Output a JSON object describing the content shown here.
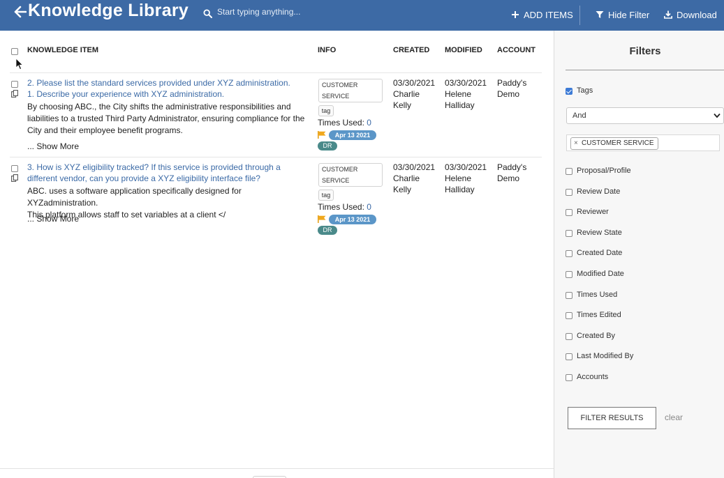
{
  "header": {
    "title": "Knowledge Library",
    "search_placeholder": "Start typing anything...",
    "add_items": "ADD ITEMS",
    "hide_filter": "Hide Filter",
    "download": "Download",
    "brand_color": "#3d6aa5"
  },
  "table": {
    "columns": [
      "KNOWLEDGE ITEM",
      "INFO",
      "CREATED",
      "MODIFIED",
      "ACCOUNT"
    ],
    "rows": [
      {
        "title_line1": "2. Please list the standard services provided under XYZ administration.",
        "title_line2": "1. Describe your experience with XYZ administration.",
        "desc_line1": "By choosing ABC., the City shifts the administrative responsibilities and",
        "desc_line2": "liabilities to a trusted Third Party Administrator, ensuring compliance for the",
        "desc_line3": "City and their employee benefit programs.",
        "show_more": "... Show More",
        "info_tag_line1": "CUSTOMER",
        "info_tag_line2": "SERVICE",
        "tag_chip": "tag",
        "times_used_label": "Times Used:",
        "times_used_value": "0",
        "date_badge": "Apr 13 2021",
        "user_badge": "DR",
        "created_date": "03/30/2021",
        "created_by_1": "Charlie",
        "created_by_2": "Kelly",
        "modified_date": "03/30/2021",
        "modified_by_1": "Helene",
        "modified_by_2": "Halliday",
        "account_1": "Paddy's",
        "account_2": "Demo"
      },
      {
        "title_line1": "3. How is XYZ eligibility tracked? If this service is provided through a",
        "title_line2": "different vendor, can you provide a XYZ eligibility interface file?",
        "desc_line1": "ABC. uses a software application specifically designed for XYZadministration.",
        "desc_line2": "This platform allows staff to set variables at a client </",
        "show_more": "... Show More",
        "info_tag_line1": "CUSTOMER",
        "info_tag_line2": "SERVICE",
        "tag_chip": "tag",
        "times_used_label": "Times Used:",
        "times_used_value": "0",
        "date_badge": "Apr 13 2021",
        "user_badge": "DR",
        "created_date": "03/30/2021",
        "created_by_1": "Charlie",
        "created_by_2": "Kelly",
        "modified_date": "03/30/2021",
        "modified_by_1": "Helene",
        "modified_by_2": "Halliday",
        "account_1": "Paddy's",
        "account_2": "Demo"
      }
    ]
  },
  "filters": {
    "title": "Filters",
    "tags_label": "Tags",
    "operator_value": "And",
    "selected_tag": "CUSTOMER SERVICE",
    "options": [
      "Proposal/Profile",
      "Review Date",
      "Reviewer",
      "Review State",
      "Created Date",
      "Modified Date",
      "Times Used",
      "Times Edited",
      "Created By",
      "Last Modified By",
      "Accounts"
    ],
    "filter_button": "FILTER RESULTS",
    "clear": "clear"
  }
}
